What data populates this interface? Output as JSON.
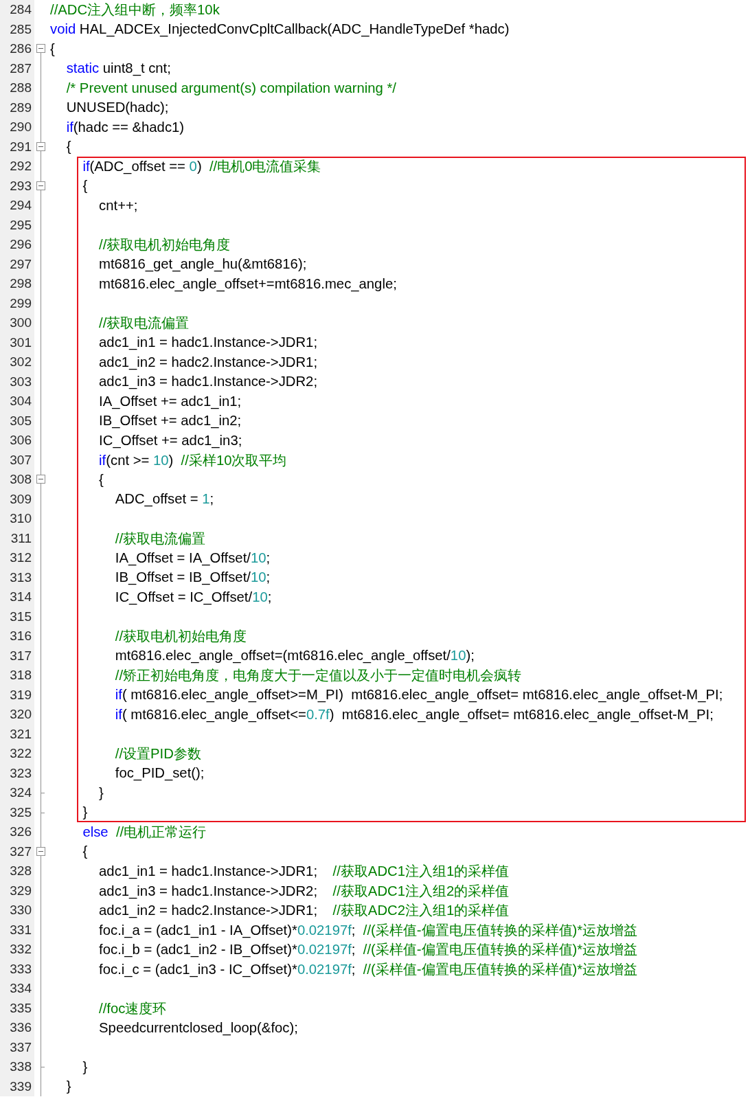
{
  "lines": [
    {
      "number": "284",
      "foldable": false,
      "fold_end": false,
      "tokens": [
        {
          "kind": "comment",
          "text": "//ADC注入组中断，频率10k"
        }
      ]
    },
    {
      "number": "285",
      "foldable": false,
      "fold_end": false,
      "tokens": [
        {
          "kind": "keyword",
          "text": "void"
        },
        {
          "kind": "plain",
          "text": " HAL_ADCEx_InjectedConvCpltCallback(ADC_HandleTypeDef *hadc)"
        }
      ]
    },
    {
      "number": "286",
      "foldable": true,
      "fold_end": false,
      "tokens": [
        {
          "kind": "plain",
          "text": "{"
        }
      ],
      "children": [
        {
          "number": "287",
          "foldable": false,
          "fold_end": false,
          "tokens": [
            {
              "kind": "keyword",
              "text": "static"
            },
            {
              "kind": "plain",
              "text": " uint8_t cnt;"
            }
          ]
        },
        {
          "number": "288",
          "foldable": false,
          "fold_end": false,
          "tokens": [
            {
              "kind": "comment",
              "text": "/* Prevent unused argument(s) compilation warning */"
            }
          ]
        },
        {
          "number": "289",
          "foldable": false,
          "fold_end": false,
          "tokens": [
            {
              "kind": "plain",
              "text": "UNUSED(hadc);"
            }
          ]
        },
        {
          "number": "290",
          "foldable": false,
          "fold_end": false,
          "tokens": [
            {
              "kind": "keyword",
              "text": "if"
            },
            {
              "kind": "plain",
              "text": "(hadc == &hadc1)"
            }
          ]
        },
        {
          "number": "291",
          "foldable": true,
          "fold_end": false,
          "tokens": [
            {
              "kind": "plain",
              "text": "{"
            }
          ],
          "children": [
            {
              "frame": true,
              "children": [
                {
                  "number": "292",
                  "foldable": false,
                  "fold_end": false,
                  "tokens": [
                    {
                      "kind": "keyword",
                      "text": "if"
                    },
                    {
                      "kind": "plain",
                      "text": "(ADC_offset == "
                    },
                    {
                      "kind": "number",
                      "text": "0"
                    },
                    {
                      "kind": "plain",
                      "text": ")  "
                    },
                    {
                      "kind": "comment",
                      "text": "//电机0电流值采集"
                    }
                  ]
                },
                {
                  "number": "293",
                  "foldable": true,
                  "fold_end": false,
                  "tokens": [
                    {
                      "kind": "plain",
                      "text": "{"
                    }
                  ],
                  "children": [
                    {
                      "number": "294",
                      "foldable": false,
                      "fold_end": false,
                      "tokens": [
                        {
                          "kind": "plain",
                          "text": "cnt++;"
                        }
                      ]
                    },
                    {
                      "number": "295",
                      "foldable": false,
                      "fold_end": false
                    },
                    {
                      "number": "296",
                      "foldable": false,
                      "fold_end": false,
                      "tokens": [
                        {
                          "kind": "comment",
                          "text": "//获取电机初始电角度"
                        }
                      ]
                    },
                    {
                      "number": "297",
                      "foldable": false,
                      "fold_end": false,
                      "tokens": [
                        {
                          "kind": "plain",
                          "text": "mt6816_get_angle_hu(&mt6816);"
                        }
                      ]
                    },
                    {
                      "number": "298",
                      "foldable": false,
                      "fold_end": false,
                      "tokens": [
                        {
                          "kind": "plain",
                          "text": "mt6816.elec_angle_offset+=mt6816.mec_angle;"
                        }
                      ]
                    },
                    {
                      "number": "299",
                      "foldable": false,
                      "fold_end": false
                    },
                    {
                      "number": "300",
                      "foldable": false,
                      "fold_end": false,
                      "tokens": [
                        {
                          "kind": "comment",
                          "text": "//获取电流偏置"
                        }
                      ]
                    },
                    {
                      "number": "301",
                      "foldable": false,
                      "fold_end": false,
                      "tokens": [
                        {
                          "kind": "plain",
                          "text": "adc1_in1 = hadc1.Instance->JDR1;"
                        }
                      ]
                    },
                    {
                      "number": "302",
                      "foldable": false,
                      "fold_end": false,
                      "tokens": [
                        {
                          "kind": "plain",
                          "text": "adc1_in2 = hadc2.Instance->JDR1;"
                        }
                      ]
                    },
                    {
                      "number": "303",
                      "foldable": false,
                      "fold_end": false,
                      "tokens": [
                        {
                          "kind": "plain",
                          "text": "adc1_in3 = hadc1.Instance->JDR2;"
                        }
                      ]
                    },
                    {
                      "number": "304",
                      "foldable": false,
                      "fold_end": false,
                      "tokens": [
                        {
                          "kind": "plain",
                          "text": "IA_Offset += adc1_in1;"
                        }
                      ]
                    },
                    {
                      "number": "305",
                      "foldable": false,
                      "fold_end": false,
                      "tokens": [
                        {
                          "kind": "plain",
                          "text": "IB_Offset += adc1_in2;"
                        }
                      ]
                    },
                    {
                      "number": "306",
                      "foldable": false,
                      "fold_end": false,
                      "tokens": [
                        {
                          "kind": "plain",
                          "text": "IC_Offset += adc1_in3;"
                        }
                      ]
                    },
                    {
                      "number": "307",
                      "foldable": false,
                      "fold_end": false,
                      "tokens": [
                        {
                          "kind": "keyword",
                          "text": "if"
                        },
                        {
                          "kind": "plain",
                          "text": "(cnt >= "
                        },
                        {
                          "kind": "number",
                          "text": "10"
                        },
                        {
                          "kind": "plain",
                          "text": ")  "
                        },
                        {
                          "kind": "comment",
                          "text": "//采样10次取平均"
                        }
                      ]
                    },
                    {
                      "number": "308",
                      "foldable": true,
                      "fold_end": false,
                      "tokens": [
                        {
                          "kind": "plain",
                          "text": "{"
                        }
                      ],
                      "children": [
                        {
                          "number": "309",
                          "foldable": false,
                          "fold_end": false,
                          "tokens": [
                            {
                              "kind": "plain",
                              "text": "ADC_offset = "
                            },
                            {
                              "kind": "number",
                              "text": "1"
                            },
                            {
                              "kind": "plain",
                              "text": ";"
                            }
                          ]
                        },
                        {
                          "number": "310",
                          "foldable": false,
                          "fold_end": false
                        },
                        {
                          "number": "311",
                          "foldable": false,
                          "fold_end": false,
                          "tokens": [
                            {
                              "kind": "comment",
                              "text": "//获取电流偏置"
                            }
                          ]
                        },
                        {
                          "number": "312",
                          "foldable": false,
                          "fold_end": false,
                          "tokens": [
                            {
                              "kind": "plain",
                              "text": "IA_Offset = IA_Offset/"
                            },
                            {
                              "kind": "number",
                              "text": "10"
                            },
                            {
                              "kind": "plain",
                              "text": ";"
                            }
                          ]
                        },
                        {
                          "number": "313",
                          "foldable": false,
                          "fold_end": false,
                          "tokens": [
                            {
                              "kind": "plain",
                              "text": "IB_Offset = IB_Offset/"
                            },
                            {
                              "kind": "number",
                              "text": "10"
                            },
                            {
                              "kind": "plain",
                              "text": ";"
                            }
                          ]
                        },
                        {
                          "number": "314",
                          "foldable": false,
                          "fold_end": false,
                          "tokens": [
                            {
                              "kind": "plain",
                              "text": "IC_Offset = IC_Offset/"
                            },
                            {
                              "kind": "number",
                              "text": "10"
                            },
                            {
                              "kind": "plain",
                              "text": ";"
                            }
                          ]
                        },
                        {
                          "number": "315",
                          "foldable": false,
                          "fold_end": false
                        },
                        {
                          "number": "316",
                          "foldable": false,
                          "fold_end": false,
                          "tokens": [
                            {
                              "kind": "comment",
                              "text": "//获取电机初始电角度"
                            }
                          ]
                        },
                        {
                          "number": "317",
                          "foldable": false,
                          "fold_end": false,
                          "tokens": [
                            {
                              "kind": "plain",
                              "text": "mt6816.elec_angle_offset=(mt6816.elec_angle_offset/"
                            },
                            {
                              "kind": "number",
                              "text": "10"
                            },
                            {
                              "kind": "plain",
                              "text": ");"
                            }
                          ]
                        },
                        {
                          "number": "318",
                          "foldable": false,
                          "fold_end": false,
                          "tokens": [
                            {
                              "kind": "comment",
                              "text": "//矫正初始电角度，电角度大于一定值以及小于一定值时电机会疯转"
                            }
                          ]
                        },
                        {
                          "number": "319",
                          "foldable": false,
                          "fold_end": false,
                          "tokens": [
                            {
                              "kind": "keyword",
                              "text": "if"
                            },
                            {
                              "kind": "plain",
                              "text": "( mt6816.elec_angle_offset>=M_PI)  mt6816.elec_angle_offset= mt6816.elec_angle_offset-M_PI;"
                            }
                          ]
                        },
                        {
                          "number": "320",
                          "foldable": false,
                          "fold_end": false,
                          "tokens": [
                            {
                              "kind": "keyword",
                              "text": "if"
                            },
                            {
                              "kind": "plain",
                              "text": "( mt6816.elec_angle_offset<="
                            },
                            {
                              "kind": "number",
                              "text": "0.7f"
                            },
                            {
                              "kind": "plain",
                              "text": ")  mt6816.elec_angle_offset= mt6816.elec_angle_offset-M_PI;"
                            }
                          ]
                        },
                        {
                          "number": "321",
                          "foldable": false,
                          "fold_end": false
                        },
                        {
                          "number": "322",
                          "foldable": false,
                          "fold_end": false,
                          "tokens": [
                            {
                              "kind": "comment",
                              "text": "//设置PID参数"
                            }
                          ]
                        },
                        {
                          "number": "323",
                          "foldable": false,
                          "fold_end": false,
                          "tokens": [
                            {
                              "kind": "plain",
                              "text": "foc_PID_set();"
                            }
                          ]
                        }
                      ]
                    },
                    {
                      "number": "324",
                      "foldable": false,
                      "fold_end": true,
                      "tokens": [
                        {
                          "kind": "plain",
                          "text": "}"
                        }
                      ]
                    }
                  ]
                },
                {
                  "number": "325",
                  "foldable": false,
                  "fold_end": true,
                  "tokens": [
                    {
                      "kind": "plain",
                      "text": "}"
                    }
                  ]
                }
              ]
            },
            {
              "number": "326",
              "foldable": false,
              "fold_end": false,
              "tokens": [
                {
                  "kind": "keyword",
                  "text": "else"
                },
                {
                  "kind": "comment",
                  "text": "  //电机正常运行"
                }
              ]
            },
            {
              "number": "327",
              "foldable": true,
              "fold_end": false,
              "tokens": [
                {
                  "kind": "plain",
                  "text": "{"
                }
              ],
              "children": [
                {
                  "number": "328",
                  "foldable": false,
                  "fold_end": false,
                  "tokens": [
                    {
                      "kind": "plain",
                      "text": "adc1_in1 = hadc1.Instance->JDR1;    "
                    },
                    {
                      "kind": "comment",
                      "text": "//获取ADC1注入组1的采样值"
                    }
                  ]
                },
                {
                  "number": "329",
                  "foldable": false,
                  "fold_end": false,
                  "tokens": [
                    {
                      "kind": "plain",
                      "text": "adc1_in3 = hadc1.Instance->JDR2;    "
                    },
                    {
                      "kind": "comment",
                      "text": "//获取ADC1注入组2的采样值"
                    }
                  ]
                },
                {
                  "number": "330",
                  "foldable": false,
                  "fold_end": false,
                  "tokens": [
                    {
                      "kind": "plain",
                      "text": "adc1_in2 = hadc2.Instance->JDR1;    "
                    },
                    {
                      "kind": "comment",
                      "text": "//获取ADC2注入组1的采样值"
                    }
                  ]
                },
                {
                  "number": "331",
                  "foldable": false,
                  "fold_end": false,
                  "tokens": [
                    {
                      "kind": "plain",
                      "text": "foc.i_a = (adc1_in1 - IA_Offset)*"
                    },
                    {
                      "kind": "number",
                      "text": "0.02197f"
                    },
                    {
                      "kind": "plain",
                      "text": ";  "
                    },
                    {
                      "kind": "comment",
                      "text": "//(采样值-偏置电压值转换的采样值)*运放增益"
                    }
                  ]
                },
                {
                  "number": "332",
                  "foldable": false,
                  "fold_end": false,
                  "tokens": [
                    {
                      "kind": "plain",
                      "text": "foc.i_b = (adc1_in2 - IB_Offset)*"
                    },
                    {
                      "kind": "number",
                      "text": "0.02197f"
                    },
                    {
                      "kind": "plain",
                      "text": ";  "
                    },
                    {
                      "kind": "comment",
                      "text": "//(采样值-偏置电压值转换的采样值)*运放增益"
                    }
                  ]
                },
                {
                  "number": "333",
                  "foldable": false,
                  "fold_end": false,
                  "tokens": [
                    {
                      "kind": "plain",
                      "text": "foc.i_c = (adc1_in3 - IC_Offset)*"
                    },
                    {
                      "kind": "number",
                      "text": "0.02197f"
                    },
                    {
                      "kind": "plain",
                      "text": ";  "
                    },
                    {
                      "kind": "comment",
                      "text": "//(采样值-偏置电压值转换的采样值)*运放增益"
                    }
                  ]
                },
                {
                  "number": "334",
                  "foldable": false,
                  "fold_end": false
                },
                {
                  "number": "335",
                  "foldable": false,
                  "fold_end": false,
                  "tokens": [
                    {
                      "kind": "comment",
                      "text": "//foc速度环"
                    }
                  ]
                },
                {
                  "number": "336",
                  "foldable": false,
                  "fold_end": false,
                  "tokens": [
                    {
                      "kind": "plain",
                      "text": "Speedcurrentclosed_loop(&foc);"
                    }
                  ]
                },
                {
                  "number": "337",
                  "foldable": false,
                  "fold_end": false
                }
              ]
            },
            {
              "number": "338",
              "foldable": false,
              "fold_end": true,
              "tokens": [
                {
                  "kind": "plain",
                  "text": "}"
                }
              ]
            }
          ]
        },
        {
          "number": "339",
          "foldable": false,
          "fold_end": false,
          "tokens": [
            {
              "kind": "plain",
              "text": "}"
            }
          ]
        }
      ]
    }
  ]
}
